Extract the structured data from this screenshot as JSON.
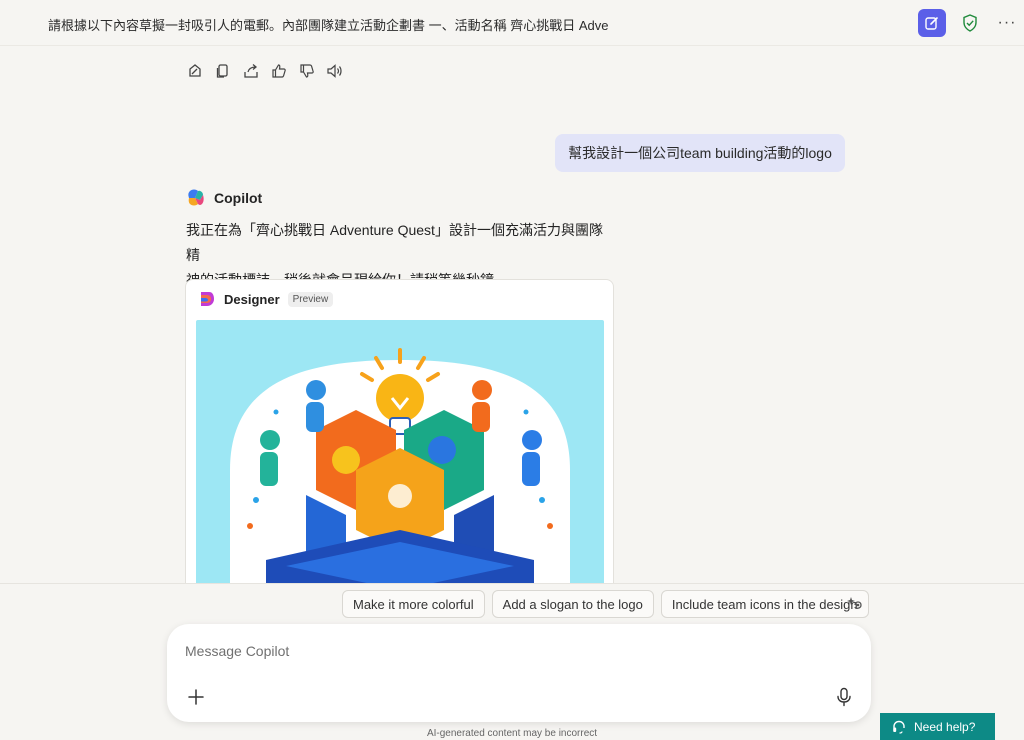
{
  "header": {
    "conversation_title": "請根據以下內容草擬一封吸引人的電郵。內部團隊建立活動企劃書 一、活動名稱 齊心挑戰日 Adventu",
    "new_chat_icon": "compose-icon",
    "shield_icon": "shield-check-icon",
    "more_label": "···"
  },
  "message_actions": [
    "edit-page-icon",
    "copy-icon",
    "share-icon",
    "thumbs-up-icon",
    "thumbs-down-icon",
    "read-aloud-icon"
  ],
  "user_message": "幫我設計一個公司team building活動的logo",
  "copilot": {
    "name": "Copilot",
    "reply_line1": "我正在為「齊心挑戰日 Adventure Quest」設計一個充滿活力與團隊精",
    "reply_line2": "神的活動標誌，稍後就會呈現給你！請稍等幾秒鐘。"
  },
  "designer": {
    "name": "Designer",
    "badge": "Preview"
  },
  "suggestions": [
    "Make it more colorful",
    "Add a slogan to the logo",
    "Include team icons in the design"
  ],
  "composer": {
    "placeholder": "Message Copilot"
  },
  "disclaimer": "AI-generated content may be incorrect",
  "help": {
    "label": "Need help?"
  },
  "colors": {
    "accent": "#5b5fe8",
    "user_bubble": "#e2e4f8",
    "help_bg": "#0d8a86",
    "image_bg": "#9de7f4"
  }
}
